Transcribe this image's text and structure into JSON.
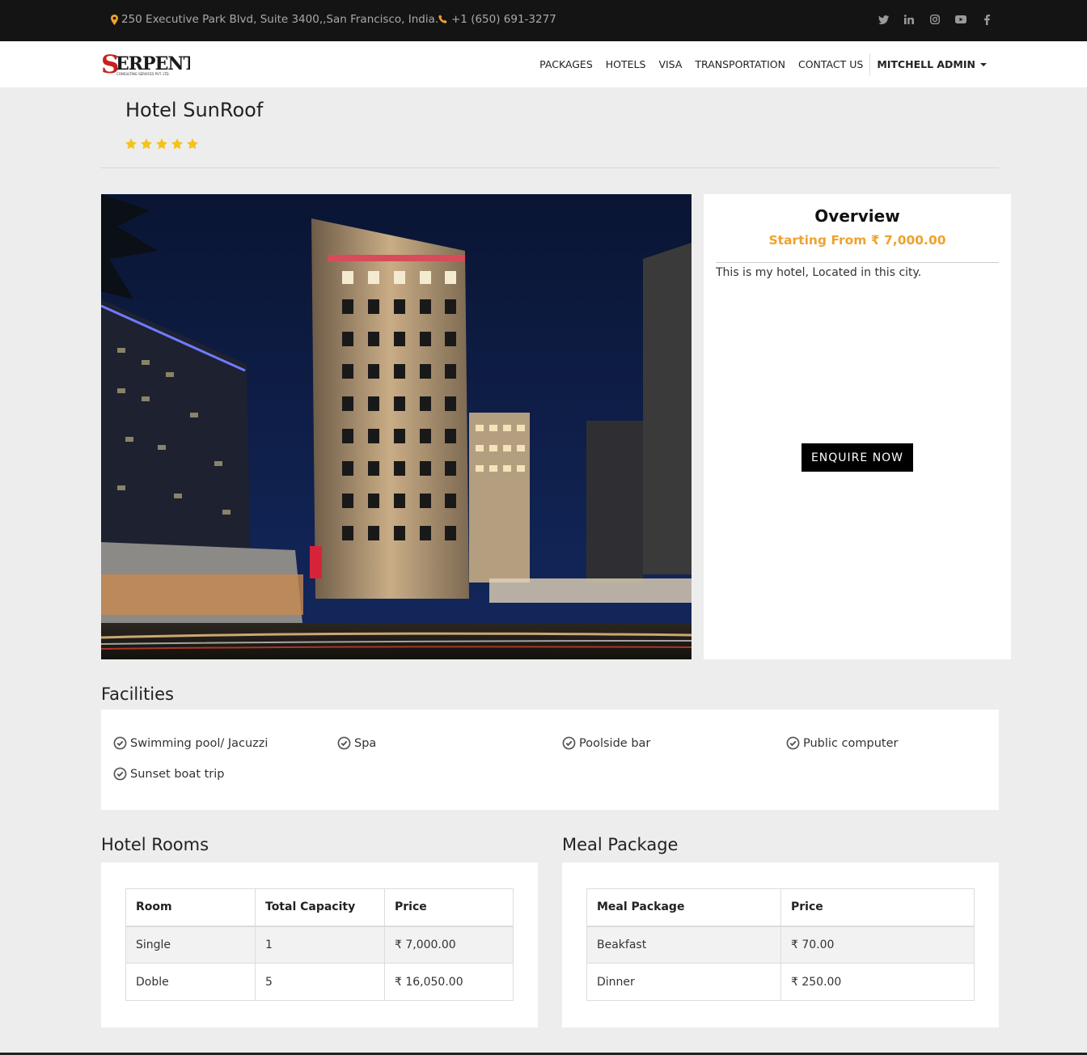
{
  "topbar": {
    "address": "250 Executive Park Blvd, Suite 3400,,San Francisco, India.",
    "phone": "+1 (650) 691-3277",
    "social_icons": [
      "twitter-icon",
      "linkedin-icon",
      "instagram-icon",
      "youtube-icon",
      "facebook-icon"
    ]
  },
  "brand": {
    "logo_text": "ERPENT",
    "logo_letter": "S",
    "logo_subtext": "CONSULTING SERVICES PVT. LTD."
  },
  "nav": {
    "items": [
      "PACKAGES",
      "HOTELS",
      "VISA",
      "TRANSPORTATION",
      "CONTACT US"
    ],
    "user": "MITCHELL ADMIN"
  },
  "hotel": {
    "name": "Hotel SunRoof",
    "rating": 5
  },
  "overview": {
    "title": "Overview",
    "starting_from": "Starting From ₹ 7,000.00",
    "description": "This is my hotel, Located in this city.",
    "enquire_label": "ENQUIRE NOW"
  },
  "facilities": {
    "title": "Facilities",
    "items": [
      "Swimming pool/ Jacuzzi",
      "Spa",
      "Poolside bar",
      "Public computer",
      "Sunset boat trip"
    ]
  },
  "rooms": {
    "title": "Hotel Rooms",
    "headers": [
      "Room",
      "Total Capacity",
      "Price"
    ],
    "rows": [
      [
        "Single",
        "1",
        "₹ 7,000.00"
      ],
      [
        "Doble",
        "5",
        "₹ 16,050.00"
      ]
    ]
  },
  "meals": {
    "title": "Meal Package",
    "headers": [
      "Meal Package",
      "Price"
    ],
    "rows": [
      [
        "Beakfast",
        "₹ 70.00"
      ],
      [
        "Dinner",
        "₹ 250.00"
      ]
    ]
  },
  "colors": {
    "accent": "#f0a22c",
    "topbar_bg": "#141414",
    "page_bg": "#ededed",
    "star": "#f4c31a",
    "button_bg": "#000000"
  }
}
